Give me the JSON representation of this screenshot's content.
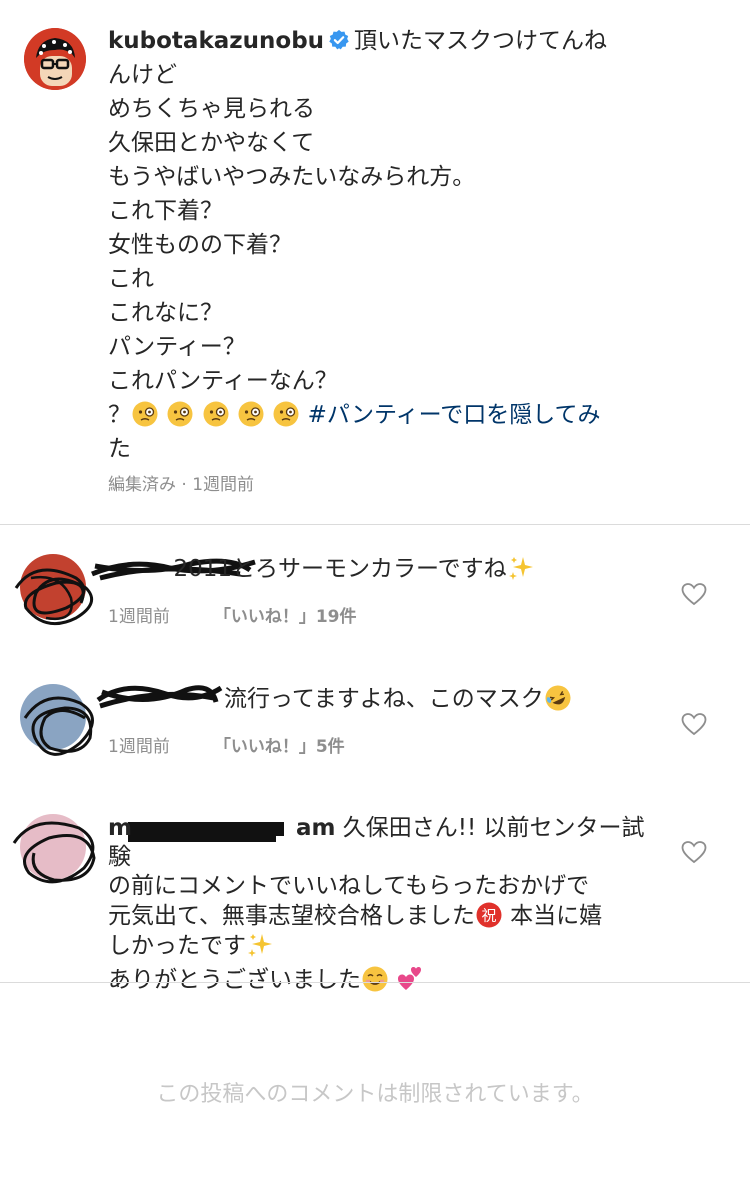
{
  "post": {
    "username": "kubotakazunobu",
    "caption_first": "頂いたマスクつけてんね",
    "caption_lines": [
      "んけど",
      "めちくちゃ見られる",
      "久保田とかやなくて",
      "もうやばいやつみたいなみられ方。",
      "これ下着？",
      "女性ものの下着？",
      "これ",
      "これなに？",
      "パンティー？",
      "これパンティーなん？"
    ],
    "caption_last_prefix": "？",
    "hashtag": "#パンティーで口を隠してみ",
    "caption_tail": "た",
    "meta": "編集済み · 1週間前"
  },
  "comments": [
    {
      "username_visible": "2011",
      "text": "とろサーモンカラーですね",
      "time": "1週間前",
      "likes": "「いいね！」19件"
    },
    {
      "username_visible": "",
      "text": "流行ってますよね、このマスク",
      "time": "1週間前",
      "likes": "「いいね！」5件"
    },
    {
      "username_visible": "m",
      "username_suffix": "am",
      "text_line1": "久保田さん!! 以前センター試験",
      "text_line2": "の前にコメントでいいねしてもらったおかげで",
      "text_line3_a": "元気出て、無事志望校合格しました",
      "text_line3_b": "本当に嬉",
      "text_line4": "しかったです",
      "text_line5": "ありがとうございました"
    }
  ],
  "footer": "この投稿へのコメントは制限されています。",
  "colors": {
    "hashtag": "#003569",
    "muted": "#8e8e8e",
    "divider": "#dbdbdb",
    "verified": "#3897f0"
  },
  "icons": [
    "verified-badge-icon",
    "face-with-monocle-emoji",
    "sparkles-emoji",
    "rolling-laughing-emoji",
    "congratulations-emoji",
    "smiling-emoji",
    "two-hearts-emoji",
    "heart-like-icon"
  ]
}
